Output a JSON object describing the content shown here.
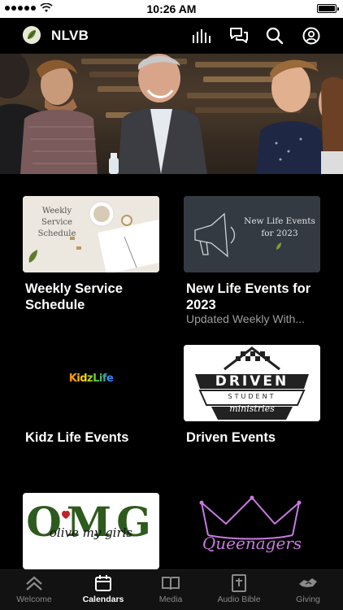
{
  "status_bar": {
    "time": "10:26 AM"
  },
  "header": {
    "title": "NLVB",
    "icons": [
      "logo-icon",
      "audio-bars-icon",
      "chat-icon",
      "search-icon",
      "profile-icon"
    ]
  },
  "hero": {
    "alt": ""
  },
  "tiles": [
    {
      "title": "Weekly Service Schedule",
      "subtitle": "",
      "image_text": "Weekly Service Schedule"
    },
    {
      "title": "New Life Events for 2023",
      "subtitle": "Updated Weekly With...",
      "image_text": "New Life Events for 2023"
    },
    {
      "title": "Kidz Life Events",
      "subtitle": "",
      "image_text": "KidzLife"
    },
    {
      "title": "Driven Events",
      "subtitle": "",
      "image_text": "DRIVEN",
      "image_sub": "STUDENT",
      "image_script": "ministries"
    },
    {
      "title": "",
      "subtitle": "",
      "image_text": "OMG",
      "image_script": "olive my girls"
    },
    {
      "title": "",
      "subtitle": "",
      "image_text": "Queenagers"
    }
  ],
  "bottom_nav": {
    "items": [
      {
        "label": "Welcome",
        "icon": "chevrons-up-icon",
        "active": false
      },
      {
        "label": "Calendars",
        "icon": "calendar-icon",
        "active": true
      },
      {
        "label": "Media",
        "icon": "book-open-icon",
        "active": false
      },
      {
        "label": "Audio Bible",
        "icon": "bible-icon",
        "active": false
      },
      {
        "label": "Giving",
        "icon": "handshake-icon",
        "active": false
      }
    ]
  },
  "colors": {
    "background": "#000000",
    "nav_bg": "#121212",
    "subtitle": "#9c9c9c",
    "accent": "#ffffff"
  }
}
